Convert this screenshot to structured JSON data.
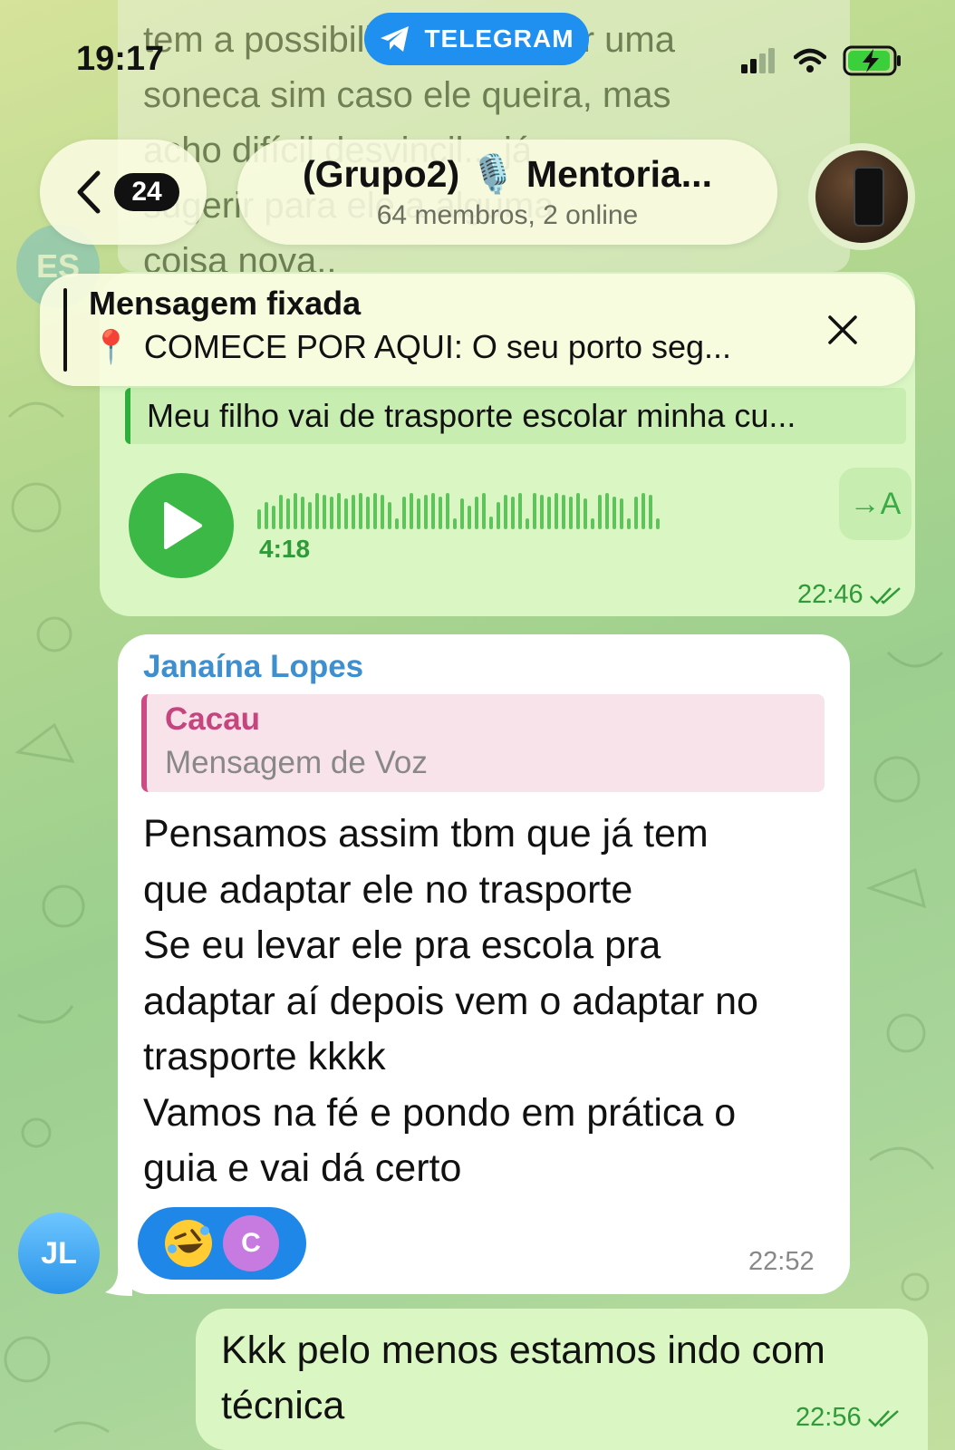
{
  "status_bar": {
    "time": "19:17",
    "source_app": "TELEGRAM"
  },
  "background_message": {
    "lines": [
      "tem a possibilidade de fazer uma",
      "soneca sim caso ele queira, mas",
      "acho difícil desvincil... já",
      "sugerir para ele a alguma",
      "coisa nova.."
    ],
    "avatar_initials": "ES"
  },
  "header": {
    "unread_count": "24",
    "title": "(Grupo2) 🎙️ Mentoria...",
    "subtitle": "64 membros, 2 online"
  },
  "pinned": {
    "label": "Mensagem fixada",
    "icon": "📍",
    "text": "COMECE POR AQUI: O seu porto seg..."
  },
  "voice_message": {
    "reply_preview": "Meu filho vai de trasporte escolar minha cu...",
    "duration": "4:18",
    "transcribe_label": "→A",
    "time": "22:46",
    "read_status": "read"
  },
  "incoming_message": {
    "sender": "Janaína Lopes",
    "sender_initials": "JL",
    "quote_author": "Cacau",
    "quote_text": "Mensagem de Voz",
    "lines": [
      "Pensamos assim tbm que já tem",
      "que adaptar ele no trasporte",
      "Se eu levar ele pra escola pra",
      "adaptar aí depois vem o adaptar no",
      "trasporte kkkk",
      "Vamos na fé e pondo em prática o",
      "guia e vai dá certo"
    ],
    "reaction_emoji": "rolling-on-floor-laughing",
    "reactor_initial": "C",
    "time": "22:52"
  },
  "outgoing_message": {
    "lines": [
      "Kkk pelo menos estamos indo com",
      "técnica"
    ],
    "time": "22:56",
    "read_status": "read"
  },
  "colors": {
    "telegram_blue": "#1f8ff0",
    "outgoing_bubble": "#d9f6c3",
    "accent_green": "#3cb846",
    "sender_blue": "#3d8fcf",
    "quote_pink": "#c5457f"
  }
}
